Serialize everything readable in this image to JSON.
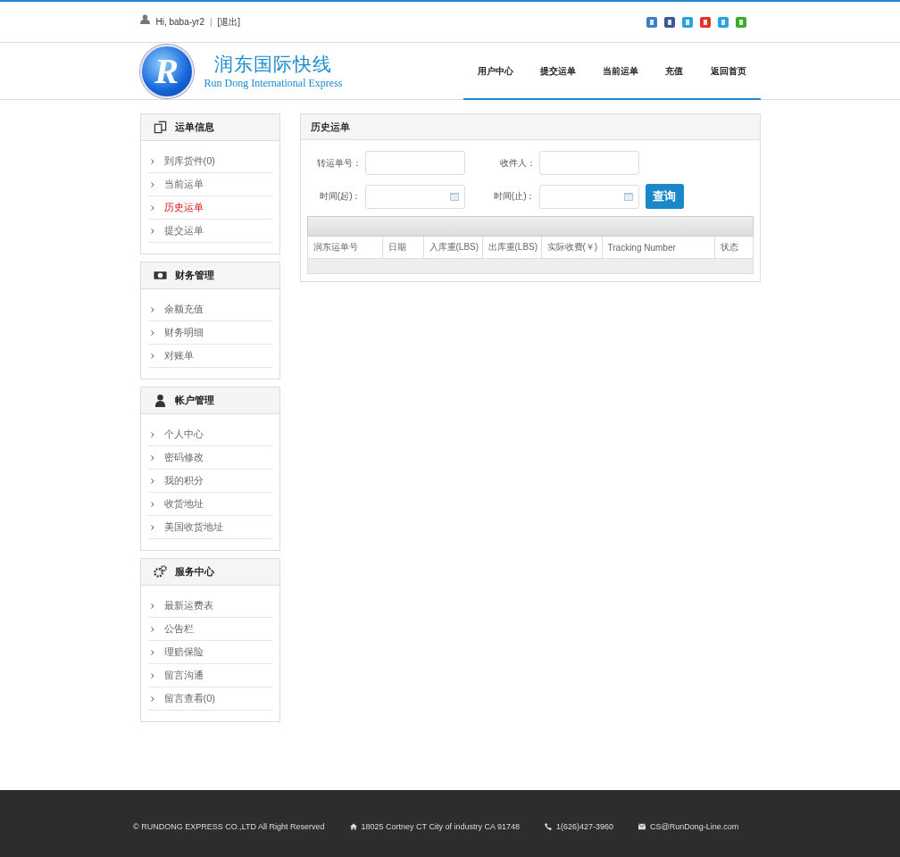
{
  "topbar": {
    "greeting": "Hi, baba-yr2",
    "separator": "|",
    "logout": "[退出]"
  },
  "logo": {
    "letter": "R",
    "title": "润东国际快线",
    "subtitle": "Run Dong International Express"
  },
  "nav": [
    "用户中心",
    "提交运单",
    "当前运单",
    "充值",
    "返回首页"
  ],
  "sidebar": [
    {
      "kind": "orders",
      "title": "运单信息",
      "items": [
        {
          "label": "到库货件(0)",
          "selected": false
        },
        {
          "label": "当前运单",
          "selected": false
        },
        {
          "label": "历史运单",
          "selected": true
        },
        {
          "label": "提交运单",
          "selected": false
        }
      ]
    },
    {
      "kind": "money",
      "title": "财务管理",
      "items": [
        {
          "label": "余额充值",
          "selected": false
        },
        {
          "label": "财务明细",
          "selected": false
        },
        {
          "label": "对账单",
          "selected": false
        }
      ]
    },
    {
      "kind": "user",
      "title": "帐户管理",
      "items": [
        {
          "label": "个人中心",
          "selected": false
        },
        {
          "label": "密码修改",
          "selected": false
        },
        {
          "label": "我的积分",
          "selected": false
        },
        {
          "label": "收货地址",
          "selected": false
        },
        {
          "label": "美国收货地址",
          "selected": false
        }
      ]
    },
    {
      "kind": "service",
      "title": "服务中心",
      "items": [
        {
          "label": "最新运费表",
          "selected": false
        },
        {
          "label": "公告栏",
          "selected": false
        },
        {
          "label": "理赔保险",
          "selected": false
        },
        {
          "label": "留言沟通",
          "selected": false
        },
        {
          "label": "留言查看(0)",
          "selected": false
        }
      ]
    }
  ],
  "panel": {
    "title": "历史运单",
    "fields": [
      {
        "label": "转运单号：",
        "kind": "text"
      },
      {
        "label": "收件人：",
        "kind": "text"
      },
      {
        "label": "时间(起)：",
        "kind": "date"
      },
      {
        "label": "时间(止)：",
        "kind": "date"
      }
    ],
    "search_button": "查询",
    "table": {
      "columns": [
        "润东运单号",
        "日期",
        "入库重(LBS)",
        "出库重(LBS)",
        "实际收费(￥)",
        "Tracking Number",
        "状态"
      ]
    }
  },
  "footer": [
    {
      "kind": "copyright",
      "text": "© RUNDONG EXPRESS CO.,LTD All Right Reserved"
    },
    {
      "kind": "address",
      "text": "18025 Cortney CT City of industry CA 91748"
    },
    {
      "kind": "phone",
      "text": "1(626)427-3960"
    },
    {
      "kind": "email",
      "text": "CS@RunDong-Line.com"
    }
  ]
}
